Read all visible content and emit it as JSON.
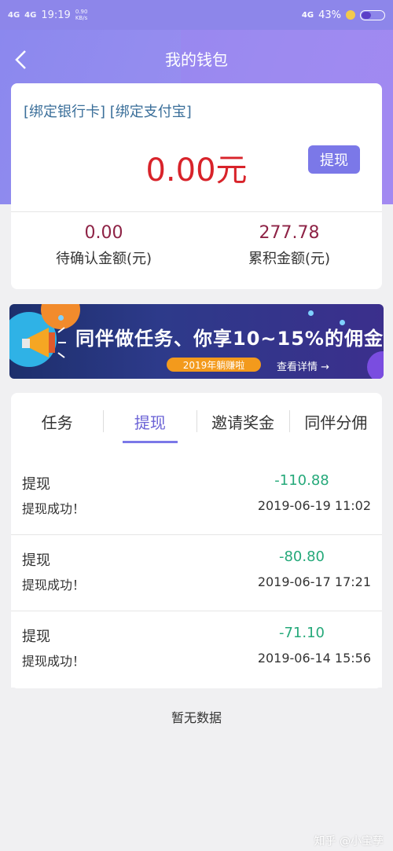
{
  "status_bar": {
    "signal1": "4G",
    "signal2": "4G",
    "time": "19:19",
    "speed": "0.90 KB/s",
    "network": "4G",
    "battery": "43%",
    "battery_level": 0.43
  },
  "header": {
    "title": "我的钱包"
  },
  "wallet": {
    "bind_bank": "[绑定银行卡]",
    "bind_alipay": "[绑定支付宝]",
    "balance": "0.00元",
    "withdraw_label": "提现",
    "pending_amount": "0.00",
    "pending_label": "待确认金额(元)",
    "total_amount": "277.78",
    "total_label": "累积金额(元)"
  },
  "banner": {
    "title": "同伴做任务、你享10~15%的佣金",
    "pill": "2019年躺赚啦",
    "more": "查看详情 →"
  },
  "tabs": [
    {
      "label": "任务"
    },
    {
      "label": "提现"
    },
    {
      "label": "邀请奖金"
    },
    {
      "label": "同伴分佣"
    }
  ],
  "records": [
    {
      "type": "提现",
      "status": "提现成功！",
      "amount": "-110.88",
      "time": "2019-06-19 11:02"
    },
    {
      "type": "提现",
      "status": "提现成功！",
      "amount": "-80.80",
      "time": "2019-06-17 17:21"
    },
    {
      "type": "提现",
      "status": "提现成功！",
      "amount": "-71.10",
      "time": "2019-06-14 15:56"
    }
  ],
  "empty_note": "暂无数据",
  "watermark": "知乎 @小宝孳",
  "colors": {
    "accent": "#7b78e8",
    "balance": "#d8232a",
    "amount": "#25a97a",
    "stat": "#8e2346"
  }
}
